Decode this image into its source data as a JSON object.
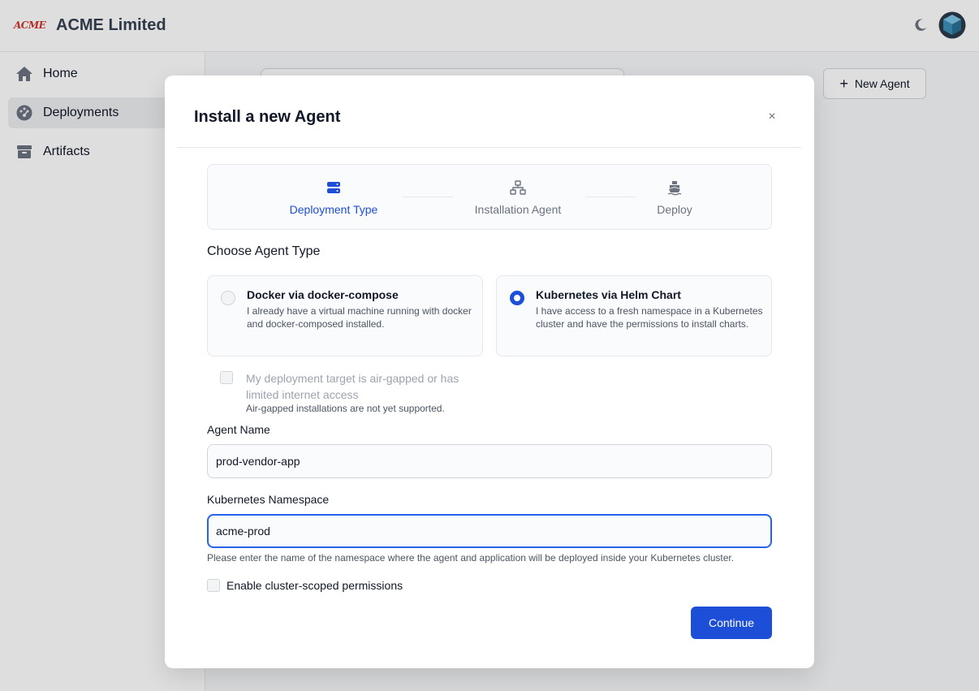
{
  "app": {
    "logo_text": "ACME",
    "title": "ACME Limited"
  },
  "sidebar": {
    "items": [
      {
        "label": "Home",
        "icon": "home-icon",
        "active": false
      },
      {
        "label": "Deployments",
        "icon": "dashboard-icon",
        "active": true
      },
      {
        "label": "Artifacts",
        "icon": "box-icon",
        "active": false
      }
    ]
  },
  "main": {
    "new_agent_label": "New Agent"
  },
  "modal": {
    "title": "Install a new Agent",
    "close_label": "×",
    "steps": [
      {
        "label": "Deployment Type",
        "icon": "server-icon",
        "active": true
      },
      {
        "label": "Installation Agent",
        "icon": "network-icon",
        "active": false
      },
      {
        "label": "Deploy",
        "icon": "ship-icon",
        "active": false
      }
    ],
    "section_label": "Choose Agent Type",
    "options": [
      {
        "title": "Docker via docker-compose",
        "description": "I already have a virtual machine running with docker and docker-composed installed.",
        "selected": false
      },
      {
        "title": "Kubernetes via Helm Chart",
        "description": "I have access to a fresh namespace in a Kubernetes cluster and have the permissions to install charts.",
        "selected": true
      }
    ],
    "airgap": {
      "label": "My deployment target is air-gapped or has limited internet access",
      "help": "Air-gapped installations are not yet supported.",
      "checked": false
    },
    "agent_name": {
      "label": "Agent Name",
      "value": "prod-vendor-app"
    },
    "namespace": {
      "label": "Kubernetes Namespace",
      "value": "acme-prod",
      "help": "Please enter the name of the namespace where the agent and application will be deployed inside your Kubernetes cluster."
    },
    "cluster_scoped": {
      "label": "Enable cluster-scoped permissions",
      "checked": false
    },
    "continue_label": "Continue"
  },
  "colors": {
    "accent": "#1d4ed8",
    "logo": "#d0362e"
  }
}
